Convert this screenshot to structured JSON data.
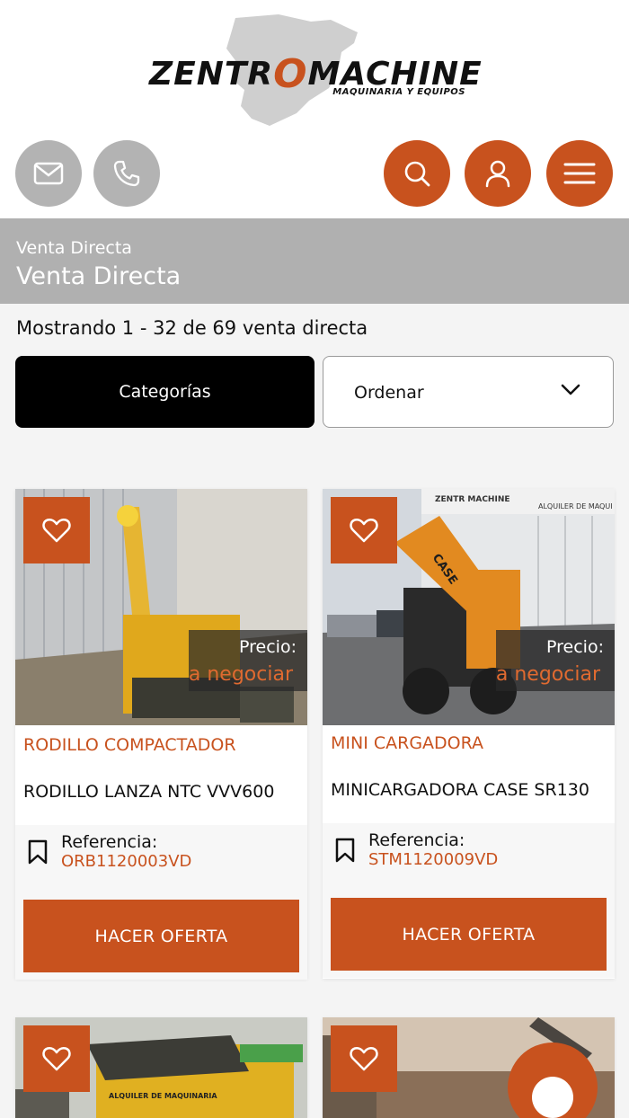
{
  "header": {
    "logo": {
      "brand_left": "ZENTR",
      "brand_o": "O",
      "brand_right": "MACHINE",
      "tagline": "MAQUINARIA Y EQUIPOS"
    },
    "icons": {
      "mail": "mail-icon",
      "phone": "phone-icon",
      "search": "search-icon",
      "user": "user-icon",
      "menu": "menu-icon"
    }
  },
  "banner": {
    "breadcrumb": "Venta Directa",
    "title": "Venta Directa"
  },
  "results": {
    "summary": "Mostrando 1 - 32 de 69 venta directa"
  },
  "filters": {
    "categories_label": "Categorías",
    "sort_label": "Ordenar"
  },
  "listings": [
    {
      "category": "RODILLO COMPACTADOR",
      "name": "RODILLO LANZA NTC VVV600",
      "price_label": "Precio:",
      "price_value": "a negociar",
      "ref_label": "Referencia:",
      "ref_value": "ORB1120003VD",
      "cta": "HACER OFERTA"
    },
    {
      "category": "MINI CARGADORA",
      "name": "MINICARGADORA CASE SR130",
      "price_label": "Precio:",
      "price_value": "a negociar",
      "ref_label": "Referencia:",
      "ref_value": "STM1120009VD",
      "cta": "HACER OFERTA",
      "photo_signs": {
        "sign1": "ZENTR  MACHINE",
        "sign2": "ALQUILER DE MAQUI",
        "brand": "CASE"
      }
    },
    {
      "photo_sign": "ALQUILER DE MAQUINARIA"
    },
    {}
  ],
  "colors": {
    "accent": "#c8521e",
    "banner": "#b0b0b0",
    "gray_button": "#b3b3b3"
  }
}
